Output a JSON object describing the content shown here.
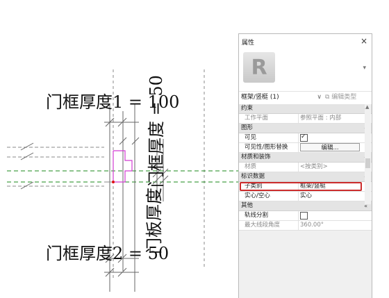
{
  "drawing": {
    "label_top": "门框厚度1 = 100",
    "label_bottom": "门框厚度2 = 50",
    "label_vertical_1": "门框厚度 = 50",
    "label_vertical_2": "门板厚度"
  },
  "properties": {
    "title": "属性",
    "close": "×",
    "type_dropdown": "▾",
    "logo_letter": "R",
    "type_selector": "框架/竖梃 (1)",
    "type_selector_chevron": "∨",
    "edit_type": "编辑类型",
    "sections": [
      {
        "label": "约束",
        "collapse": "«"
      },
      {
        "label": "图形",
        "collapse": "«"
      },
      {
        "label": "材质和装饰",
        "collapse": "«"
      },
      {
        "label": "标识数据",
        "collapse": "«"
      },
      {
        "label": "其他",
        "collapse": "«"
      }
    ],
    "rows": {
      "work_plane": {
        "key": "工作平面",
        "value": "参照平面 : 内部"
      },
      "visible": {
        "key": "可见",
        "checked": true
      },
      "vg_override": {
        "key": "可见性/图形替换",
        "button": "编辑..."
      },
      "material": {
        "key": "材质",
        "value": "<按类别>"
      },
      "subcategory": {
        "key": "子类别",
        "value": "框架/竖梃"
      },
      "solid_void": {
        "key": "实心/空心",
        "value": "实心"
      },
      "trace_split": {
        "key": "轨线分割",
        "checked": false
      },
      "max_angle": {
        "key": "最大线段角度",
        "value": "360.00°"
      }
    },
    "highlight_color": "#cc2c2c"
  }
}
